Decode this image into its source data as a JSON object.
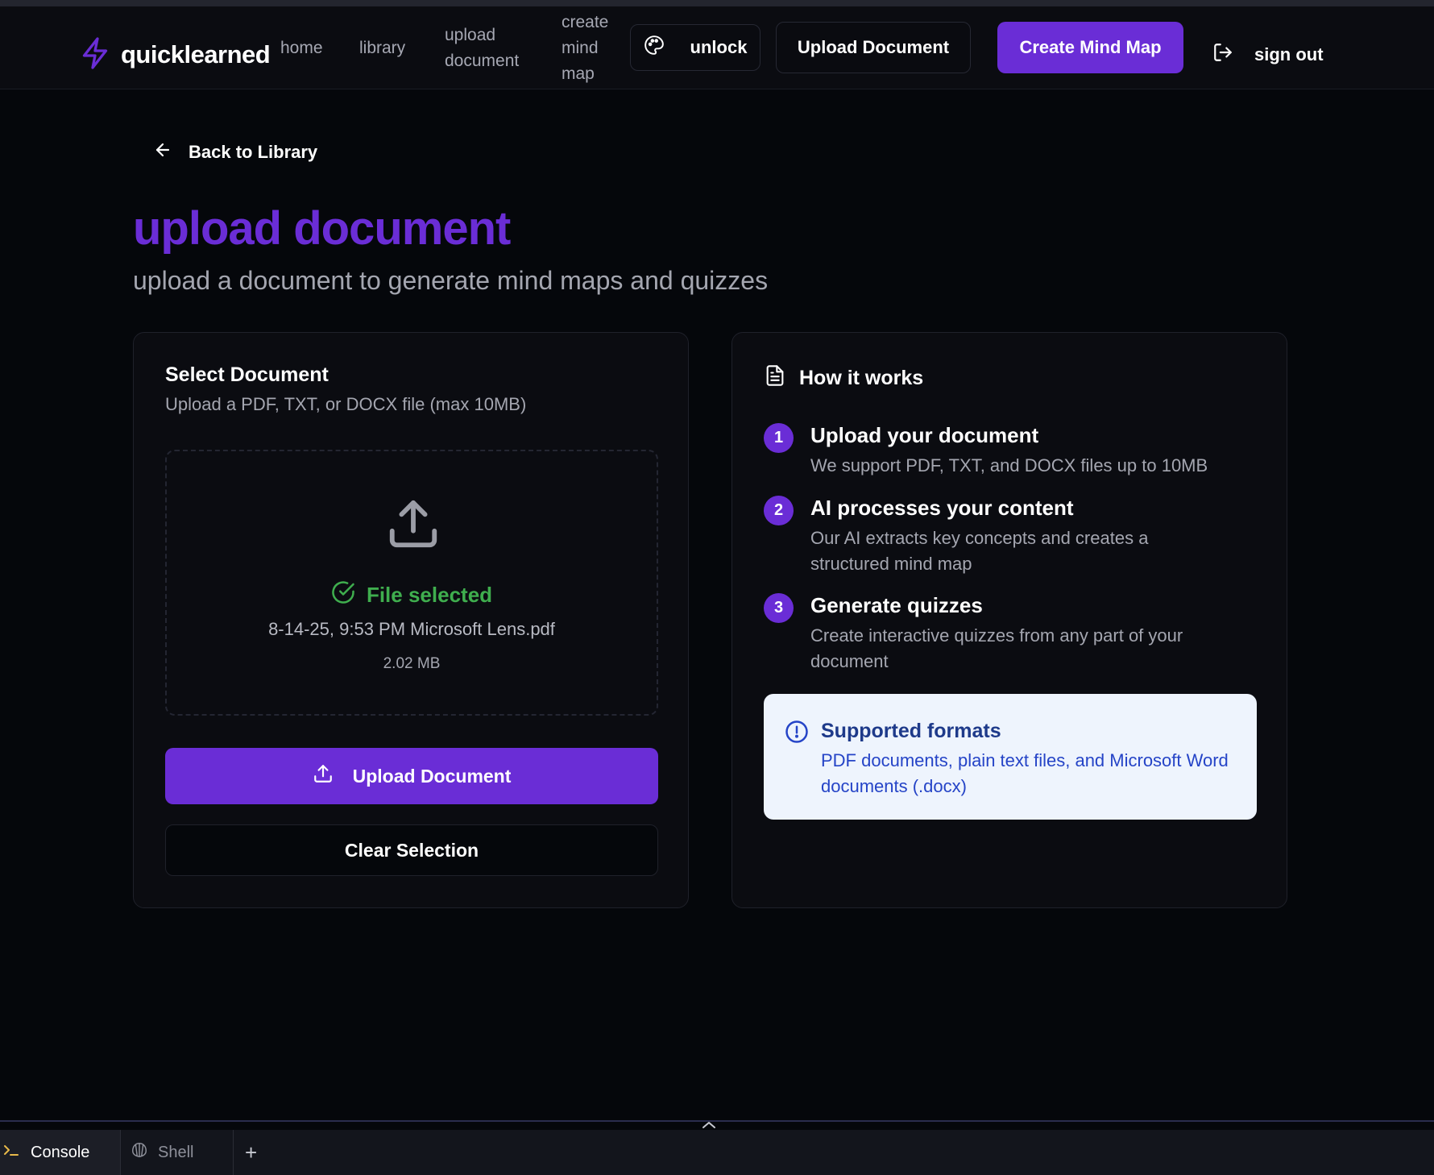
{
  "nav": {
    "brand": "quicklearned",
    "links": [
      {
        "line1": "home"
      },
      {
        "line1": "library"
      },
      {
        "line1": "upload",
        "line2": "document"
      },
      {
        "line1": "create",
        "line2": "mind",
        "line3": "map"
      }
    ],
    "theme_label": "unlock",
    "upload_label": "Upload Document",
    "create_label": "Create Mind Map",
    "signout_label": "sign out"
  },
  "back_label": "Back to Library",
  "page": {
    "title": "upload document",
    "subtitle": "upload a document to generate mind maps and quizzes"
  },
  "select_card": {
    "title": "Select Document",
    "description": "Upload a PDF, TXT, or DOCX file (max 10MB)",
    "status": "File selected",
    "file_name": "8-14-25, 9:53 PM Microsoft Lens.pdf",
    "file_size": "2.02 MB",
    "upload_button": "Upload Document",
    "clear_button": "Clear Selection"
  },
  "how_it_works": {
    "title": "How it works",
    "steps": [
      {
        "number": "1",
        "title": "Upload your document",
        "description": "We support PDF, TXT, and DOCX files up to 10MB"
      },
      {
        "number": "2",
        "title": "AI processes your content",
        "description": "Our AI extracts key concepts and creates a structured mind map"
      },
      {
        "number": "3",
        "title": "Generate quizzes",
        "description": "Create interactive quizzes from any part of your document"
      }
    ],
    "formats_title": "Supported formats",
    "formats_description": "PDF documents, plain text files, and Microsoft Word documents (.docx)"
  },
  "bottom_bar": {
    "console_label": "Console",
    "shell_label": "Shell",
    "add_label": "+"
  },
  "colors": {
    "accent": "#6a2dd6",
    "success": "#3fae4e",
    "background": "#05070b",
    "info_bg": "#eef4fd",
    "info_text": "#2544c7"
  }
}
